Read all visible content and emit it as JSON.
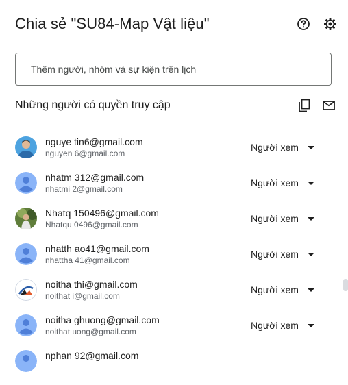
{
  "dialog": {
    "title": "Chia sẻ \"SU84-Map Vật liệu\"",
    "add_placeholder": "Thêm người, nhóm và sự kiện trên lịch",
    "section_title": "Những người có quyền truy cập",
    "help_icon": "help-circle-icon",
    "settings_icon": "gear-icon",
    "copy_icon": "copy-icon",
    "email_icon": "mail-icon"
  },
  "people": [
    {
      "email": "nguye      tin6@gmail.com",
      "sub": "nguyen       6@gmail.com",
      "role": "Người xem",
      "avatar": "photo-avatar"
    },
    {
      "email": "nhatm      312@gmail.com",
      "sub": "nhatmi      2@gmail.com",
      "role": "Người xem",
      "avatar": "default-avatar"
    },
    {
      "email": "Nhatq      150496@gmail.com",
      "sub": "Nhatqu      0496@gmail.com",
      "role": "Người xem",
      "avatar": "photo-avatar"
    },
    {
      "email": "nhatth      ao41@gmail.com",
      "sub": "nhattha      41@gmail.com",
      "role": "Người xem",
      "avatar": "default-avatar"
    },
    {
      "email": "noitha      thi@gmail.com",
      "sub": "noithat      i@gmail.com",
      "role": "Người xem",
      "avatar": "logo-avatar"
    },
    {
      "email": "noitha      ghuong@gmail.com",
      "sub": "noithat      uong@gmail.com",
      "role": "Người xem",
      "avatar": "default-avatar"
    },
    {
      "email": "nphan      92@gmail.com",
      "sub": "",
      "role": "",
      "avatar": "default-avatar"
    }
  ],
  "colors": {
    "avatar_default": "#8ab4f8",
    "text_primary": "#1f1f1f",
    "text_secondary": "#5f6368",
    "divider": "#c4c7c5"
  }
}
